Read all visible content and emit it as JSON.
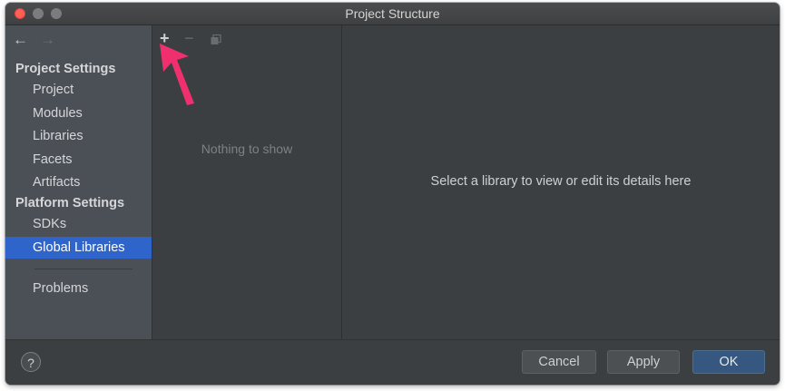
{
  "window": {
    "title": "Project Structure"
  },
  "sidebar": {
    "back_icon": "←",
    "forward_icon": "→",
    "sections": [
      {
        "header": "Project Settings",
        "items": [
          "Project",
          "Modules",
          "Libraries",
          "Facets",
          "Artifacts"
        ]
      },
      {
        "header": "Platform Settings",
        "items": [
          "SDKs",
          "Global Libraries"
        ]
      }
    ],
    "extra_items": [
      "Problems"
    ],
    "selected_item": "Global Libraries"
  },
  "list_toolbar": {
    "add_icon": "+",
    "remove_icon": "−",
    "copy_icon": "copy-icon"
  },
  "list": {
    "empty_text": "Nothing to show"
  },
  "detail": {
    "placeholder": "Select a library to view or edit its details here"
  },
  "footer": {
    "help_label": "?",
    "cancel_label": "Cancel",
    "apply_label": "Apply",
    "ok_label": "OK"
  },
  "colors": {
    "sidebar_bg": "#4b5057",
    "selection": "#2f65ca",
    "primary_button": "#365880",
    "annotation_arrow": "#f0306e"
  }
}
